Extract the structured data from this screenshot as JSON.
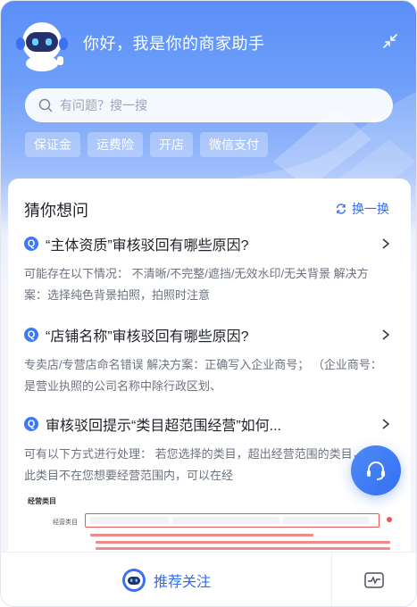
{
  "header": {
    "title": "你好，我是你的商家助手"
  },
  "search": {
    "placeholder": "有问题？搜一搜"
  },
  "chips": [
    "保证金",
    "运费险",
    "开店",
    "微信支付"
  ],
  "guess": {
    "title": "猜你想问",
    "refresh_label": "换一换",
    "questions": [
      {
        "badge": "Q",
        "title": "“主体资质”审核驳回有哪些原因?",
        "body": "可能存在以下情况： 不清晰/不完整/遮挡/无效水印/无关背景 解决方案：选择纯色背景拍照，拍照时注意"
      },
      {
        "badge": "Q",
        "title": "“店铺名称”审核驳回有哪些原因?",
        "body": "专卖店/专营店命名错误 解决方案：正确写入企业商号； （企业商号：是营业执照的公司名称中除行政区划、"
      },
      {
        "badge": "Q",
        "title": "审核驳回提示“类目超范围经营”如何...",
        "body": "可有以下方式进行处理： 若您选择的类目，超出经营范围的类目，同时此类目不在您想要经营范围内，可以在经"
      }
    ],
    "preview": {
      "section_label": "经营类目",
      "field_label": "经营类目"
    }
  },
  "footer": {
    "follow_label": "推荐关注"
  },
  "colors": {
    "accent": "#2f6bf5",
    "header_gradient_top": "#5b8ff8",
    "badge": "#3f78f6"
  },
  "icons": {
    "avatar": "robot-avatar-icon",
    "collapse": "collapse-arrows-icon",
    "search": "search-icon",
    "refresh": "refresh-icon",
    "arrow": "chevron-right-icon",
    "fab": "headset-icon",
    "chart": "chart-icon"
  }
}
